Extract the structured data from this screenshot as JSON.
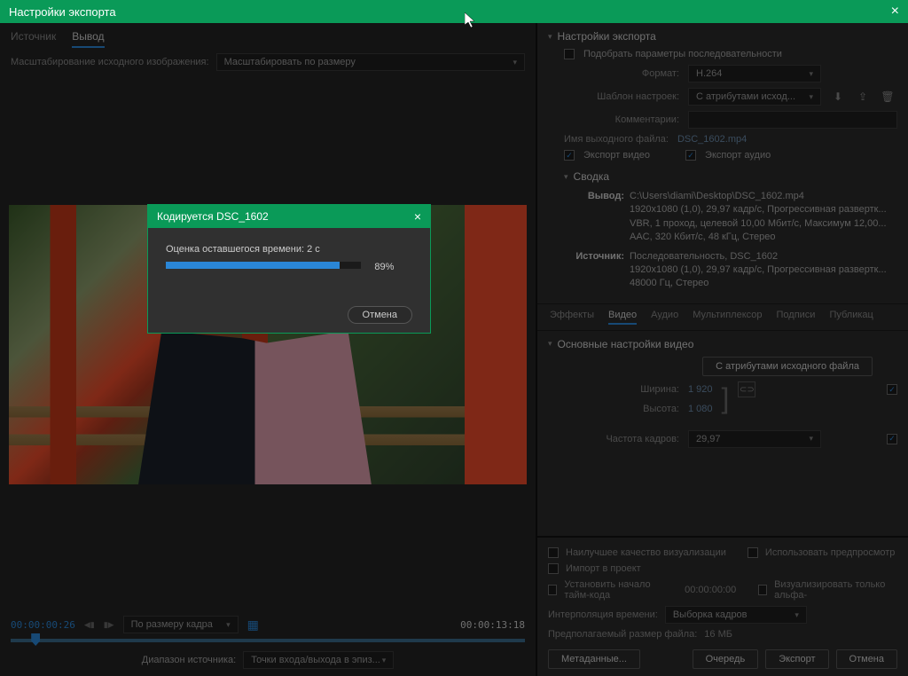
{
  "window": {
    "title": "Настройки экспорта"
  },
  "left": {
    "tabs": {
      "source": "Источник",
      "output": "Вывод"
    },
    "scaleLabel": "Масштабирование исходного изображения:",
    "scaleValue": "Масштабировать по размеру",
    "timeline": {
      "start": "00:00:00:26",
      "end": "00:00:13:18",
      "fitLabel": "По размеру кадра",
      "rangeLabel": "Диапазон источника:",
      "rangeValue": "Точки входа/выхода в эпиз..."
    }
  },
  "encode": {
    "title": "Кодируется DSC_1602",
    "est": "Оценка оставшегося времени: 2 с",
    "percent": "89%",
    "cancel": "Отмена"
  },
  "export": {
    "header": "Настройки экспорта",
    "matchSeq": "Подобрать параметры последовательности",
    "formatLabel": "Формат:",
    "formatValue": "H.264",
    "presetLabel": "Шаблон настроек:",
    "presetValue": "С атрибутами исход...",
    "commentsLabel": "Комментарии:",
    "outputNameLabel": "Имя выходного файла:",
    "outputName": "DSC_1602.mp4",
    "exportVideo": "Экспорт видео",
    "exportAudio": "Экспорт аудио",
    "summaryHeader": "Сводка",
    "summary": {
      "outputKey": "Вывод:",
      "outputLine1": "C:\\Users\\diami\\Desktop\\DSC_1602.mp4",
      "outputLine2": "1920x1080 (1,0), 29,97 кадр/с, Прогрессивная развертк...",
      "outputLine3": "VBR, 1 проход, целевой 10,00 Мбит/с, Максимум 12,00...",
      "outputLine4": "AAC, 320 Кбит/с, 48 кГц, Стерео",
      "sourceKey": "Источник:",
      "sourceLine1": "Последовательность, DSC_1602",
      "sourceLine2": "1920x1080 (1,0), 29,97 кадр/с, Прогрессивная развертк...",
      "sourceLine3": "48000 Гц, Стерео"
    },
    "tabs2": {
      "effects": "Эффекты",
      "video": "Видео",
      "audio": "Аудио",
      "mux": "Мультиплексор",
      "captions": "Подписи",
      "publish": "Публикац"
    },
    "videoHeader": "Основные настройки видео",
    "matchSourceBtn": "С атрибутами исходного файла",
    "widthLabel": "Ширина:",
    "widthValue": "1 920",
    "heightLabel": "Высота:",
    "heightValue": "1 080",
    "fpsLabel": "Частота кадров:",
    "fpsValue": "29,97"
  },
  "bottom": {
    "bestQuality": "Наилучшее качество визуализации",
    "usePreview": "Использовать предпросмотр",
    "importProject": "Импорт в проект",
    "setTimecode": "Установить начало тайм-кода",
    "timecodeValue": "00:00:00:00",
    "renderAlpha": "Визуализировать только альфа-",
    "interpLabel": "Интерполяция времени:",
    "interpValue": "Выборка кадров",
    "estSizeLabel": "Предполагаемый размер файла:",
    "estSizeValue": "16 МБ",
    "metadata": "Метаданные...",
    "queue": "Очередь",
    "export": "Экспорт",
    "cancel": "Отмена"
  }
}
